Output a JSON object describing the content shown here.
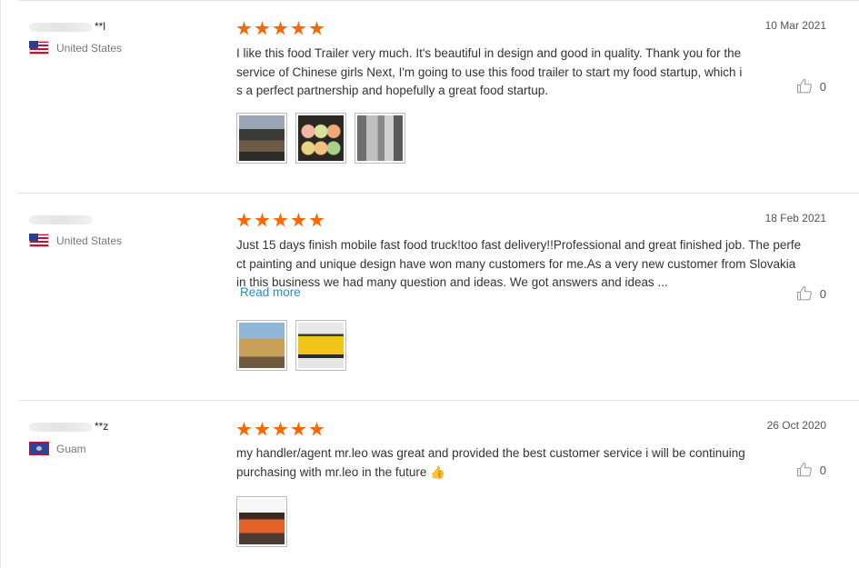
{
  "reviews": [
    {
      "buyer": "**l",
      "country": "United States",
      "flag": "us-flag-icon",
      "rating": 5,
      "date": "10 Mar 2021",
      "text": "I like this food Trailer very much. It's beautiful in design and good in quality. Thank you for the service of Chinese girls Next, I'm going to use this food trailer to start my food startup, which is a perfect partnership and hopefully a great food startup.",
      "likes": "0",
      "photo_count": 3
    },
    {
      "buyer": "",
      "country": "United States",
      "flag": "us-flag-icon",
      "rating": 5,
      "date": "18 Feb 2021",
      "text": "Just 15 days finish mobile fast food truck!too fast delivery!!Professional and great finished job. The perfect painting and unique design have won many customers for me.As a very new customer from Slovakia in this business we had many question and ideas. We got answers and ideas ...",
      "read_more": "Read more",
      "likes": "0",
      "photo_count": 2
    },
    {
      "buyer": "**z",
      "country": "Guam",
      "flag": "guam-flag-icon",
      "rating": 5,
      "date": "26 Oct 2020",
      "text": "my handler/agent mr.leo was great and provided the best customer service i will be continuing purchasing with mr.leo in the future 👍",
      "likes": "0",
      "photo_count": 1
    }
  ],
  "colors": {
    "star": "#ff6600",
    "link": "#1e8fd6"
  }
}
